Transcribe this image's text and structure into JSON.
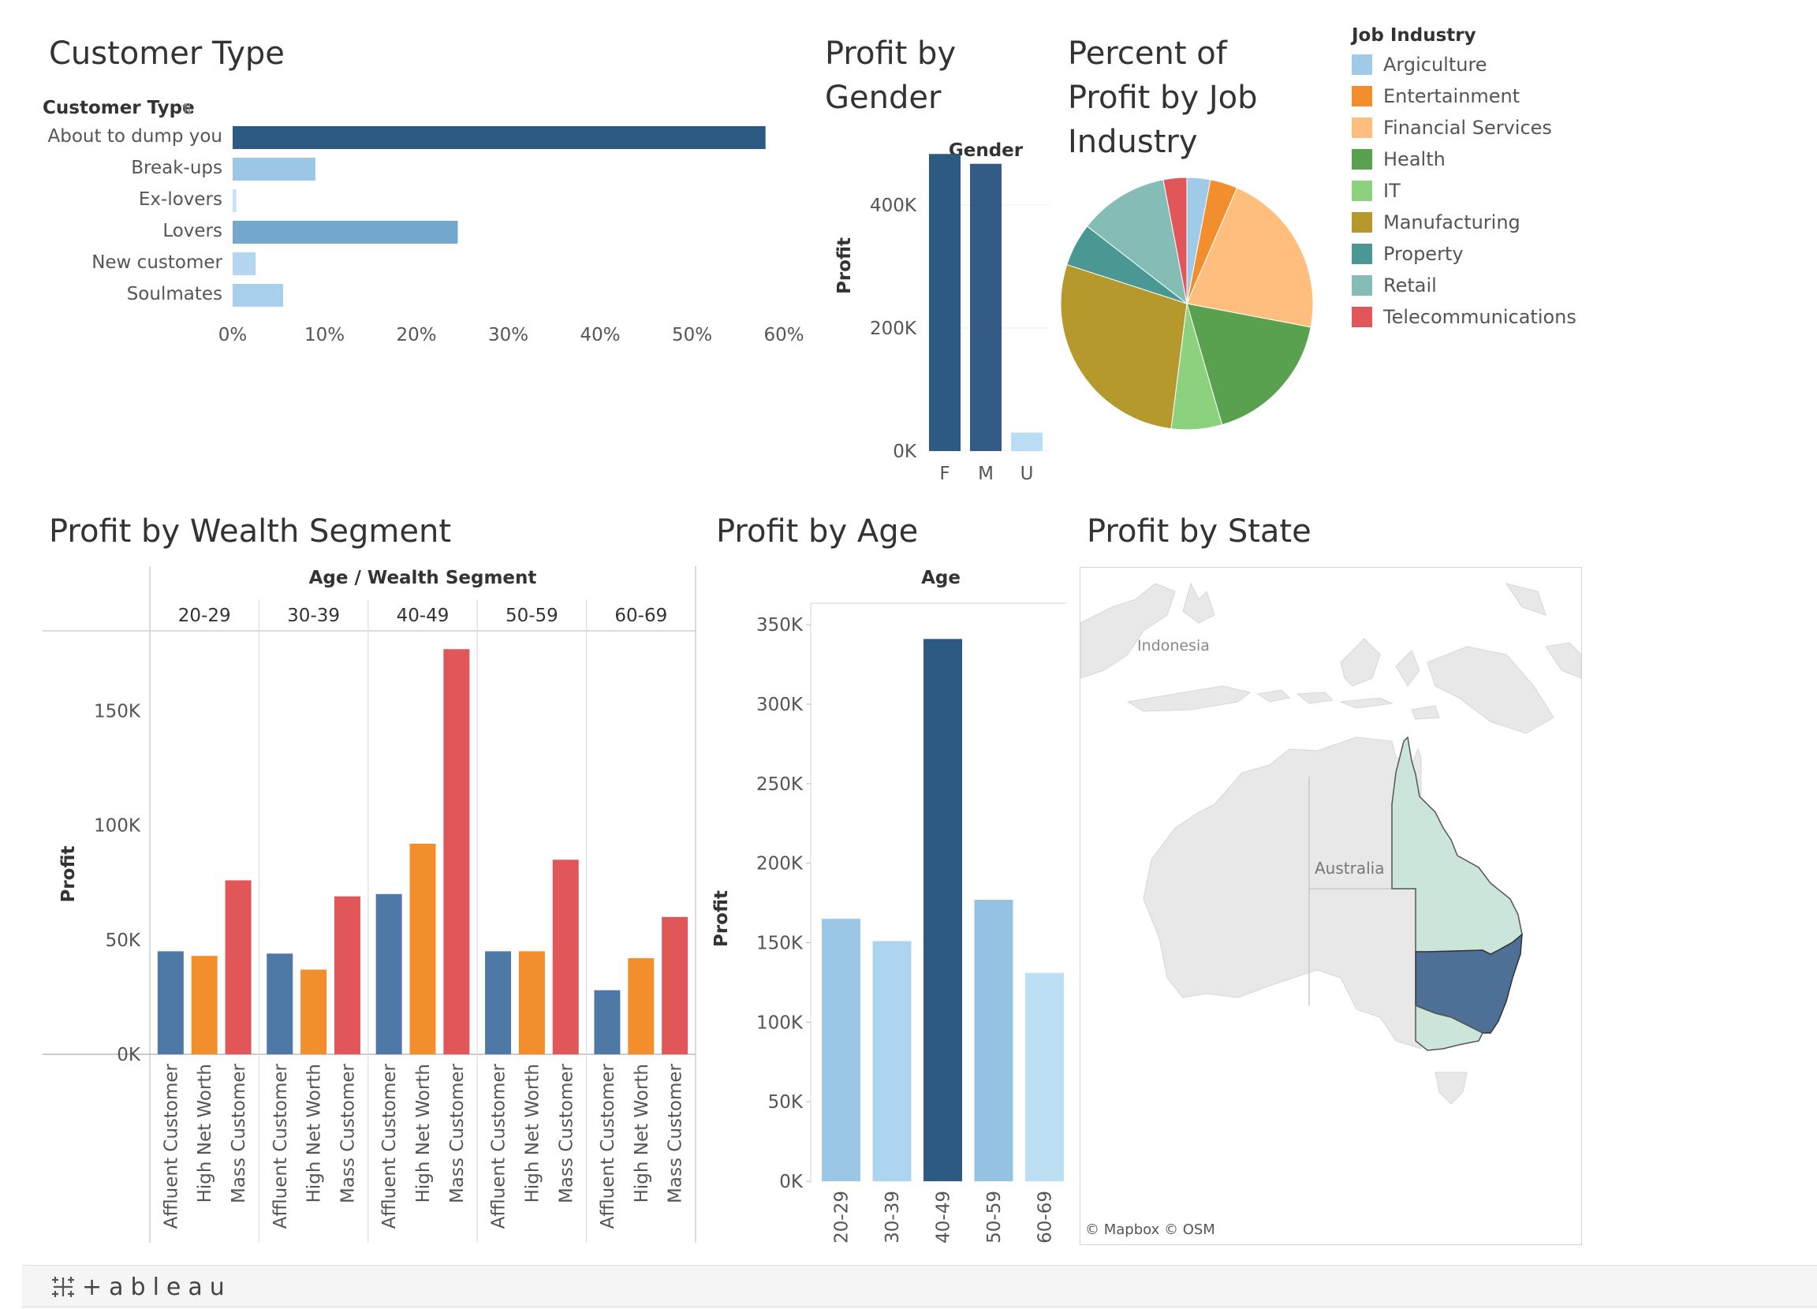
{
  "titles": {
    "customer_type": "Customer Type",
    "profit_by_gender": [
      "Profit by",
      "Gender"
    ],
    "percent_profit_job": [
      "Percent of",
      "Profit by Job",
      "Industry"
    ],
    "wealth_segment": "Profit by Wealth Segment",
    "profit_by_age": "Profit by Age",
    "profit_by_state": "Profit by State"
  },
  "legend": {
    "title": "Job Industry",
    "items": [
      {
        "label": "Argiculture",
        "color": "#a0cbe8"
      },
      {
        "label": "Entertainment",
        "color": "#f28e2b"
      },
      {
        "label": "Financial Services",
        "color": "#ffbe7d"
      },
      {
        "label": "Health",
        "color": "#59a14f"
      },
      {
        "label": "IT",
        "color": "#8cd17d"
      },
      {
        "label": "Manufacturing",
        "color": "#b6992d"
      },
      {
        "label": "Property",
        "color": "#499894"
      },
      {
        "label": "Retail",
        "color": "#86bcb6"
      },
      {
        "label": "Telecommunications",
        "color": "#e15759"
      }
    ]
  },
  "map": {
    "labels": {
      "indonesia": "Indonesia",
      "australia": "Australia"
    },
    "attribution": "© Mapbox  © OSM",
    "colors": {
      "qld": "#cce5da",
      "nsw": "#4e6f96",
      "vic": "#cce5da",
      "land": "#e8e8e8"
    }
  },
  "footer": {
    "logo_text": "+ableau"
  },
  "chart_data": [
    {
      "id": "customer_type",
      "type": "bar",
      "orientation": "horizontal",
      "title": "Customer Type",
      "header": "Customer Type",
      "categories": [
        "About to dump you",
        "Break-ups",
        "Ex-lovers",
        "Lovers",
        "New customer",
        "Soulmates"
      ],
      "values": [
        58,
        9,
        0.4,
        24.5,
        2.5,
        5.5
      ],
      "colors": [
        "#2d5a82",
        "#9bc6e5",
        "#c6e1f3",
        "#74a7ce",
        "#b4d7ef",
        "#a8d0ed"
      ],
      "xticks": [
        "0%",
        "10%",
        "20%",
        "30%",
        "40%",
        "50%",
        "60%"
      ],
      "xlim": [
        0,
        60
      ],
      "unit": "%"
    },
    {
      "id": "profit_by_gender",
      "type": "bar",
      "header": "Gender",
      "ylabel": "Profit",
      "categories": [
        "F",
        "M",
        "U"
      ],
      "values": [
        483000,
        467000,
        30000
      ],
      "colors": [
        "#2d5a82",
        "#335b85",
        "#b9ddf2"
      ],
      "yticks": [
        0,
        200000,
        400000
      ],
      "ytick_labels": [
        "0K",
        "200K",
        "400K"
      ],
      "ylim": [
        0,
        500000
      ]
    },
    {
      "id": "percent_profit_job",
      "type": "pie",
      "categories": [
        "Argiculture",
        "Entertainment",
        "Financial Services",
        "Health",
        "IT",
        "Manufacturing",
        "Property",
        "Retail",
        "Telecommunications"
      ],
      "values": [
        3.0,
        3.5,
        21.5,
        17.5,
        6.5,
        28.0,
        5.5,
        11.5,
        3.0
      ],
      "colors": [
        "#a0cbe8",
        "#f28e2b",
        "#ffbe7d",
        "#59a14f",
        "#8cd17d",
        "#b6992d",
        "#499894",
        "#86bcb6",
        "#e15759"
      ]
    },
    {
      "id": "wealth_segment",
      "type": "bar",
      "header": "Age / Wealth Segment",
      "ylabel": "Profit",
      "groups": [
        "20-29",
        "30-39",
        "40-49",
        "50-59",
        "60-69"
      ],
      "segments": [
        "Affluent Customer",
        "High Net Worth",
        "Mass Customer"
      ],
      "segment_colors": [
        "#4e79a7",
        "#f28e2b",
        "#e15759"
      ],
      "values": [
        [
          45000,
          43000,
          76000
        ],
        [
          44000,
          37000,
          69000
        ],
        [
          70000,
          92000,
          177000
        ],
        [
          45000,
          45000,
          85000
        ],
        [
          28000,
          42000,
          60000
        ]
      ],
      "yticks": [
        0,
        50000,
        100000,
        150000
      ],
      "ytick_labels": [
        "0K",
        "50K",
        "100K",
        "150K"
      ],
      "ylim": [
        0,
        185000
      ]
    },
    {
      "id": "profit_by_age",
      "type": "bar",
      "header": "Age",
      "ylabel": "Profit",
      "categories": [
        "20-29",
        "30-39",
        "40-49",
        "50-59",
        "60-69"
      ],
      "values": [
        165000,
        151000,
        341000,
        177000,
        131000
      ],
      "colors": [
        "#9bc6e5",
        "#acd4ee",
        "#2d5a82",
        "#95c1e2",
        "#bcdff3"
      ],
      "yticks": [
        0,
        50000,
        100000,
        150000,
        200000,
        250000,
        300000,
        350000
      ],
      "ytick_labels": [
        "0K",
        "50K",
        "100K",
        "150K",
        "200K",
        "250K",
        "300K",
        "350K"
      ],
      "ylim": [
        0,
        360000
      ]
    }
  ]
}
